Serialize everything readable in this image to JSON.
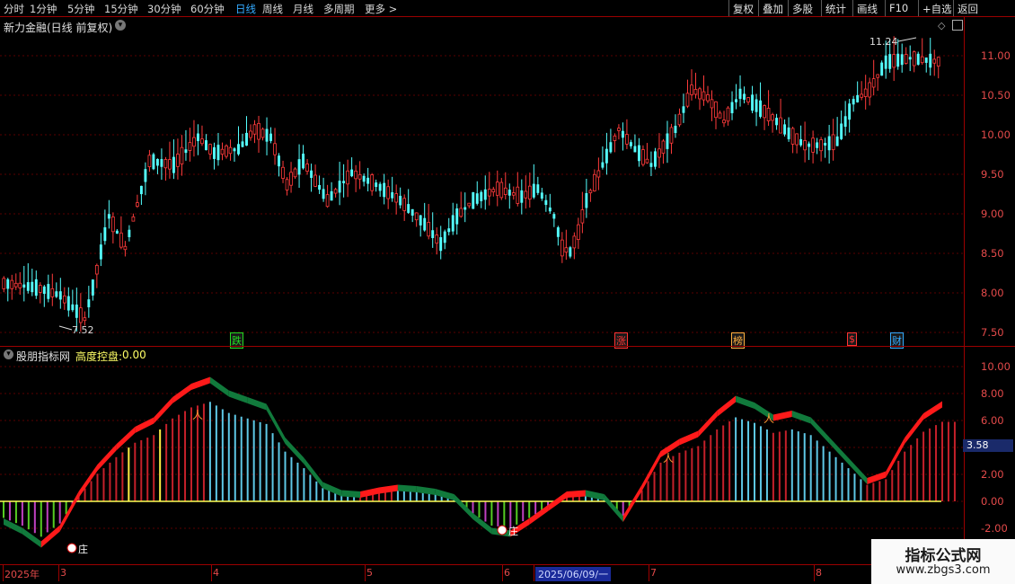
{
  "toolbar": {
    "periods": [
      {
        "label": "分时",
        "active": false
      },
      {
        "label": "1分钟",
        "active": false
      },
      {
        "label": "5分钟",
        "active": false
      },
      {
        "label": "15分钟",
        "active": false
      },
      {
        "label": "30分钟",
        "active": false
      },
      {
        "label": "60分钟",
        "active": false
      },
      {
        "label": "日线",
        "active": true
      },
      {
        "label": "周线",
        "active": false
      },
      {
        "label": "月线",
        "active": false
      },
      {
        "label": "多周期",
        "active": false
      },
      {
        "label": "更多 >",
        "active": false
      }
    ],
    "right_buttons": [
      "复权",
      "叠加",
      "多股",
      "统计",
      "画线",
      "F10",
      "+自选",
      "返回"
    ],
    "active_color": "#33aaff"
  },
  "main_chart": {
    "title": "新力金融(日线 前复权)",
    "y_axis_labels": [
      "11.00",
      "10.50",
      "10.00",
      "9.50",
      "9.00",
      "8.50",
      "8.00",
      "7.50"
    ],
    "high_marker": "11.24",
    "low_marker": "7.52",
    "up_color": "#ff3b3b",
    "down_color": "#54ffff",
    "event_badges": [
      {
        "text": "跌",
        "color": "#22dd22"
      },
      {
        "text": "涨",
        "color": "#ff3333"
      },
      {
        "text": "榜",
        "color": "#ffb040"
      },
      {
        "text": "$",
        "color": "#ff3333"
      },
      {
        "text": "财",
        "color": "#33aaff"
      }
    ]
  },
  "indicator": {
    "name": "股朋指标网",
    "param_label": "高度控盘:",
    "param_value": "0.00",
    "y_axis_labels": [
      "10.00",
      "8.00",
      "6.00",
      "4.00",
      "2.00",
      "0.00",
      "-2.00"
    ],
    "current_value": "3.58",
    "entry_label": "庄",
    "colors": {
      "rising": "#ff1a1a",
      "falling": "#117a3c",
      "hist_red": "#c4202a",
      "hist_cyan": "#5ec8e6",
      "hist_green": "#55cc22",
      "hist_magenta": "#c040c0",
      "hist_yellow": "#ffee44"
    }
  },
  "date_axis": {
    "labels": [
      "2025年",
      "3",
      "4",
      "5",
      "6",
      "2025/06/09/一",
      "7",
      "8"
    ]
  },
  "watermark": {
    "line1": "指标公式网",
    "line2": "www.zbgs3.com"
  },
  "chart_data": {
    "type": "line",
    "title": "新力金融(日线 前复权)",
    "price_high": 11.24,
    "price_low": 7.52,
    "ylim": [
      7.4,
      11.4
    ],
    "indicator_ylim": [
      -3,
      11
    ],
    "indicator_current": 3.58,
    "indicator_series": {
      "name": "高度控盘",
      "values": [
        -1.5,
        -2.2,
        -3.2,
        -2.0,
        0.5,
        2.5,
        4.0,
        5.3,
        6.0,
        7.5,
        8.5,
        9.0,
        8.0,
        7.5,
        7.0,
        4.5,
        3.0,
        1.2,
        0.6,
        0.5,
        0.8,
        1.0,
        0.9,
        0.7,
        0.3,
        -1.1,
        -2.2,
        -2.4,
        -1.5,
        -0.5,
        0.5,
        0.6,
        0.3,
        -1.3,
        1.0,
        3.5,
        4.4,
        5.0,
        6.5,
        7.6,
        7.1,
        6.2,
        6.5,
        6.0,
        4.5,
        3.0,
        1.5,
        2.0,
        4.5,
        6.3,
        7.2
      ]
    }
  }
}
